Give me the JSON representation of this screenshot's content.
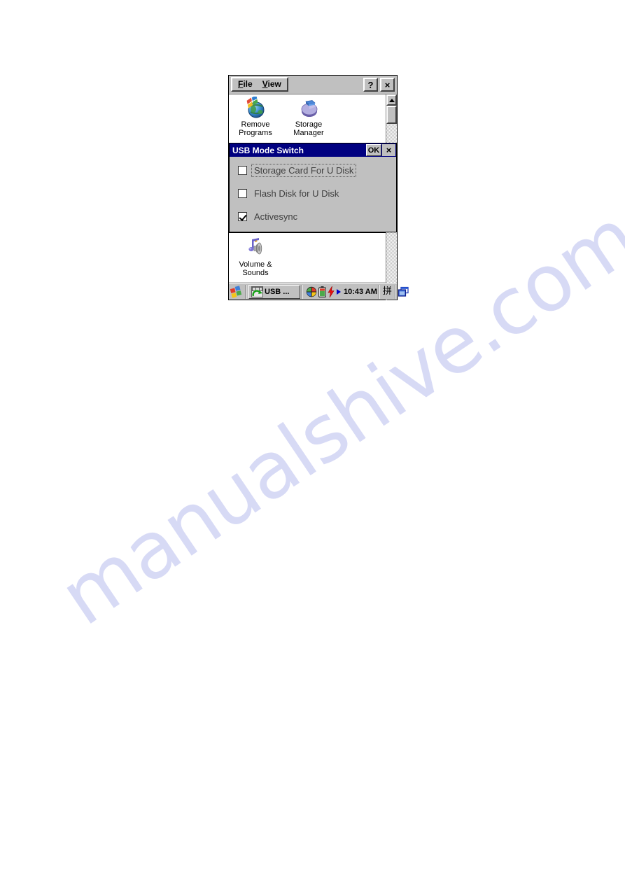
{
  "page": {
    "watermark_text": "manualshive.com",
    "background": "#ffffff"
  },
  "window": {
    "menus": [
      {
        "name": "file",
        "label": "File",
        "accel": "F"
      },
      {
        "name": "view",
        "label": "View",
        "accel": "V"
      }
    ],
    "help_button_label": "?",
    "close_button_label": "×"
  },
  "control_panel": {
    "top_icons": [
      {
        "icon": "remove-programs-icon",
        "line1": "Remove",
        "line2": "Programs"
      },
      {
        "icon": "storage-manager-icon",
        "line1": "Storage",
        "line2": "Manager"
      }
    ],
    "bottom_icons": [
      {
        "icon": "volume-sounds-icon",
        "line1": "Volume &",
        "line2": "Sounds"
      }
    ]
  },
  "scrollbar": {
    "up_label": "▲",
    "down_label": "▼"
  },
  "dialog": {
    "title": "USB Mode Switch",
    "ok_label": "OK",
    "close_label": "×",
    "options": [
      {
        "name": "storage-card-for-u-disk",
        "label": "Storage Card For U Disk",
        "checked": false,
        "focused": true
      },
      {
        "name": "flash-disk-for-u-disk",
        "label": "Flash Disk for U Disk",
        "checked": false,
        "focused": false
      },
      {
        "name": "activesync",
        "label": "Activesync",
        "checked": true,
        "focused": false
      }
    ]
  },
  "taskbar": {
    "start_icon": "windows-start-icon",
    "task_button": {
      "icon": "usb-task-icon",
      "label": "USB ..."
    },
    "tray": [
      {
        "name": "network-icon"
      },
      {
        "name": "battery-icon"
      },
      {
        "name": "power-bolt-icon"
      },
      {
        "name": "media-play-icon"
      }
    ],
    "clock": "10:43 AM",
    "ime_indicator": "拼",
    "desktop_icon": "cascade-windows-icon"
  },
  "colors": {
    "face": "#c0c0c0",
    "titlebar_active": "#000080",
    "client_bg": "#ffffff",
    "text": "#000000",
    "disabled_text": "#3f3f3f",
    "watermark": "#c9ccf2"
  }
}
